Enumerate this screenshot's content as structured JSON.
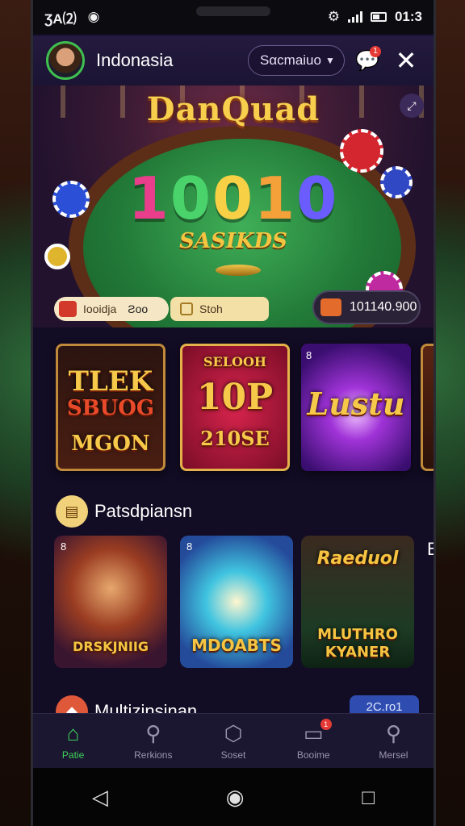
{
  "status_bar": {
    "left_text": "ƷA⑵",
    "time": "01:3"
  },
  "header": {
    "region": "Indonasia",
    "search_label": "Sαcmaiuo",
    "chat_badge": "1"
  },
  "hero": {
    "brand": "DanQuad",
    "jackpot_digits": [
      "1",
      "0",
      "0",
      "1",
      "0"
    ],
    "jackpot_colors": [
      "#e83e8c",
      "#4ad36b",
      "#f7d046",
      "#f4a13a",
      "#6a5cff"
    ],
    "subtitle": "SASIKDS",
    "pill_left": "Iooidja",
    "pill_left_extra": "Ƨoo",
    "pill_mid": "Stoh",
    "balance": "101140.900"
  },
  "featured_games": [
    {
      "line1": "TLEK",
      "line2": "SBUOG",
      "line3": "MGON"
    },
    {
      "line1": "SELOOH",
      "line2": "10P",
      "line3": "210SE"
    },
    {
      "line1": "Lustu",
      "corner": "8"
    }
  ],
  "section_popular": {
    "title": "Patsdpiansn"
  },
  "popular_games": [
    {
      "label": "DRSKJNIIG",
      "corner": "8"
    },
    {
      "label": "MDOABTS",
      "corner": "8"
    },
    {
      "top": "Raeduol",
      "line1": "MLUTHRO",
      "line2": "KYANER"
    }
  ],
  "peek_letter": "B",
  "section_multi": {
    "title": "Multizinsinan",
    "pager": "2C.ro1"
  },
  "bottom_nav": [
    {
      "label": "Patie",
      "icon": "home-icon"
    },
    {
      "label": "Rerkions",
      "icon": "search-icon"
    },
    {
      "label": "Soset",
      "icon": "shield-icon"
    },
    {
      "label": "Booime",
      "icon": "chat-icon",
      "badge": "1"
    },
    {
      "label": "Mersel",
      "icon": "search-icon"
    }
  ],
  "colors": {
    "accent_green": "#3bd25a",
    "gold": "#f5c542",
    "badge_red": "#e53935"
  }
}
